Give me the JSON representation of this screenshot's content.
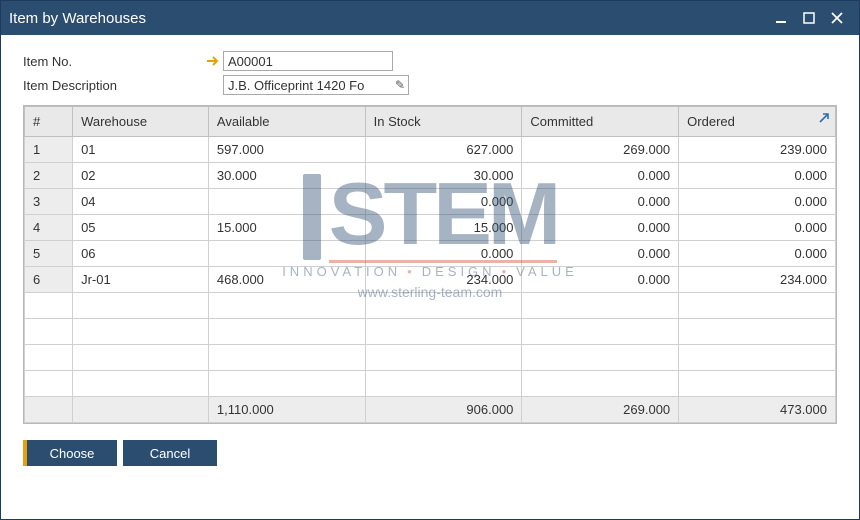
{
  "window": {
    "title": "Item by Warehouses"
  },
  "form": {
    "item_no_label": "Item No.",
    "item_no_value": "A00001",
    "item_desc_label": "Item Description",
    "item_desc_value": "J.B. Officeprint 1420 Fo"
  },
  "grid": {
    "headers": {
      "idx": "#",
      "wh": "Warehouse",
      "avail": "Available",
      "stock": "In Stock",
      "commit": "Committed",
      "order": "Ordered"
    },
    "rows": [
      {
        "idx": "1",
        "wh": "01",
        "avail": "597.000",
        "stock": "627.000",
        "commit": "269.000",
        "order": "239.000"
      },
      {
        "idx": "2",
        "wh": "02",
        "avail": "30.000",
        "stock": "30.000",
        "commit": "0.000",
        "order": "0.000"
      },
      {
        "idx": "3",
        "wh": "04",
        "avail": "",
        "stock": "0.000",
        "commit": "0.000",
        "order": "0.000"
      },
      {
        "idx": "4",
        "wh": "05",
        "avail": "15.000",
        "stock": "15.000",
        "commit": "0.000",
        "order": "0.000"
      },
      {
        "idx": "5",
        "wh": "06",
        "avail": "",
        "stock": "0.000",
        "commit": "0.000",
        "order": "0.000"
      },
      {
        "idx": "6",
        "wh": "Jr-01",
        "avail": "468.000",
        "stock": "234.000",
        "commit": "0.000",
        "order": "234.000"
      }
    ],
    "totals": {
      "avail": "1,110.000",
      "stock": "906.000",
      "commit": "269.000",
      "order": "473.000"
    }
  },
  "buttons": {
    "choose": "Choose",
    "cancel": "Cancel"
  },
  "watermark": {
    "logo": "STEM",
    "tagline1": "INNOVATION",
    "tagline2": "DESIGN",
    "tagline3": "VALUE",
    "url": "www.sterling-team.com"
  }
}
